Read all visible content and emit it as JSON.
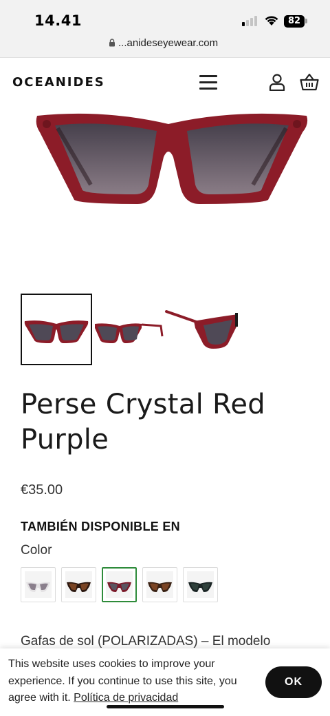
{
  "status_bar": {
    "time": "14.41",
    "battery": "82"
  },
  "browser": {
    "url": "...anideseyewear.com"
  },
  "header": {
    "logo": "OCEANIDES"
  },
  "product": {
    "title": "Perse Crystal Red Purple",
    "price": "€35.00",
    "also_available_heading": "TAMBIÉN DISPONIBLE EN",
    "color_label": "Color",
    "description_start": "Gafas de sol (POLARIZADAS) – El modelo",
    "frame_color": "#8c1c28",
    "lens_color": "#5a5460",
    "color_swatches": [
      {
        "frame": "#e8e6e8",
        "lens": "#8a7f8c",
        "selected": false
      },
      {
        "frame": "#3a1f14",
        "lens": "#6b3a22",
        "selected": false
      },
      {
        "frame": "#7a1a2a",
        "lens": "#5a5460",
        "selected": true
      },
      {
        "frame": "#4a2a18",
        "lens": "#6b3a22",
        "selected": false
      },
      {
        "frame": "#1f2a2a",
        "lens": "#2d3a36",
        "selected": false
      }
    ]
  },
  "cookie_bar": {
    "text": "This website uses cookies to improve your experience. If you continue to use this site, you agree with it.",
    "link_label": "Política de privacidad",
    "ok_label": "OK",
    "selected_swatch_border": "#2e8b3a"
  }
}
